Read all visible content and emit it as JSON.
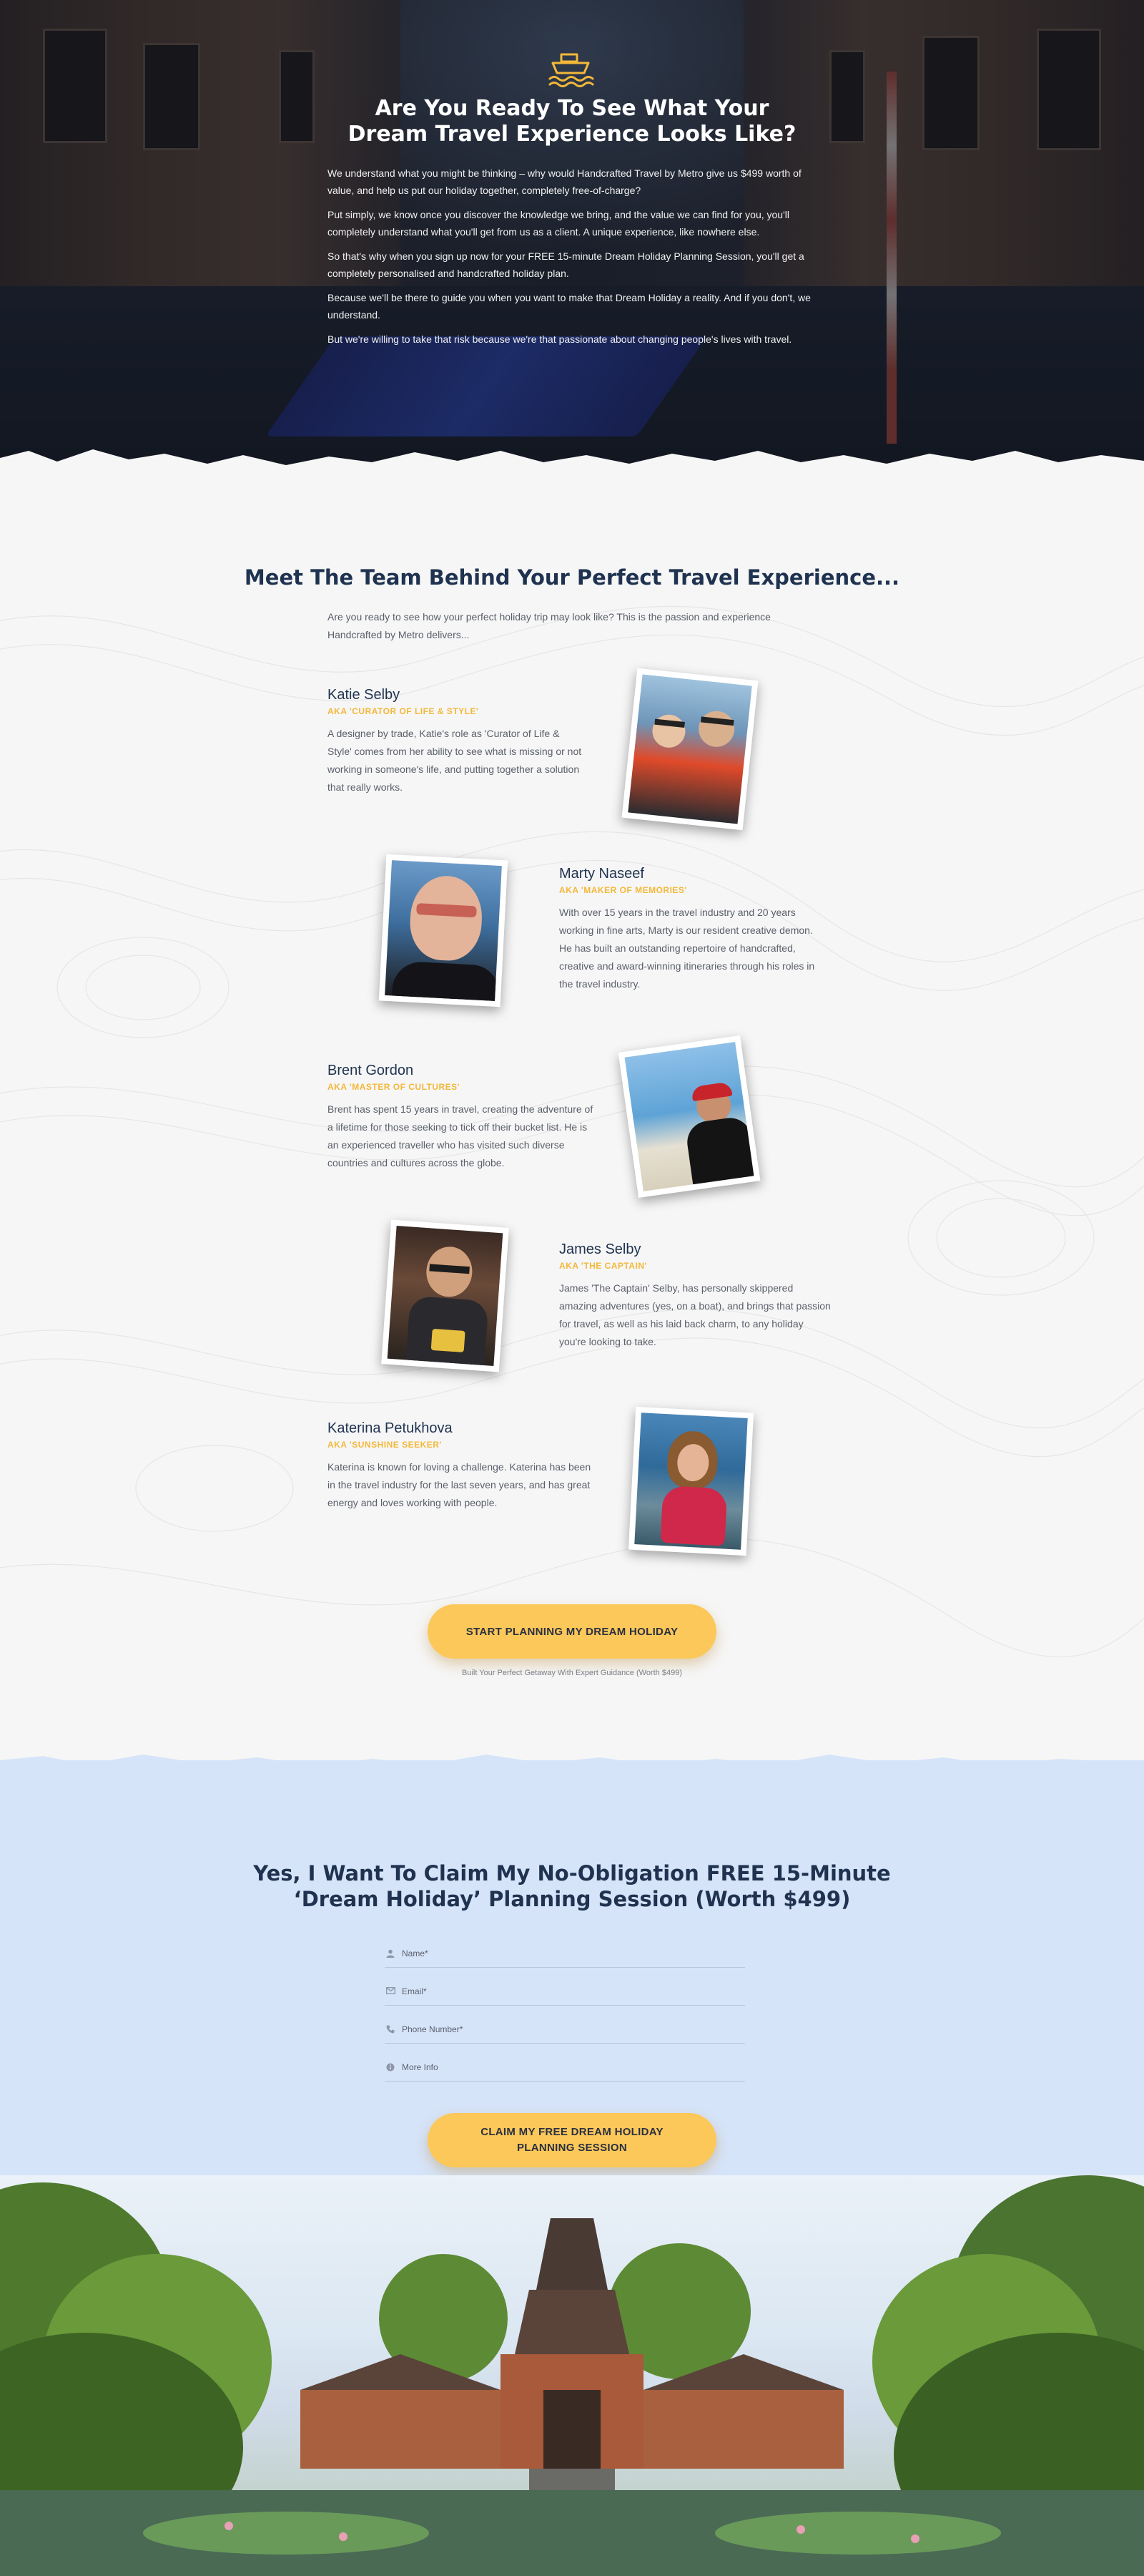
{
  "hero": {
    "icon": "ship-icon",
    "title_line1": "Are You Ready To See What Your",
    "title_line2": "Dream Travel Experience Looks Like?",
    "paragraphs": [
      "We understand what you might be thinking – why would Handcrafted Travel by Metro give us $499 worth of value, and help us put our holiday together, completely free-of-charge?",
      "Put simply, we know once you discover the knowledge we bring, and the value we can find for you, you'll completely understand what you'll get from us as a client. A unique experience, like nowhere else.",
      "So that's why when you sign up now for your FREE 15-minute Dream Holiday Planning Session, you'll get a completely personalised and handcrafted holiday plan.",
      "Because we'll be there to guide you when you want to make that Dream Holiday a reality. And if you don't, we understand.",
      "But we're willing to take that risk because we're that passionate about changing people's lives with travel."
    ]
  },
  "team": {
    "title": "Meet The Team Behind Your Perfect Travel Experience...",
    "intro": "Are you ready to see how your perfect holiday trip may look like? This is the passion and experience Handcrafted by Metro delivers...",
    "members": [
      {
        "name": "Katie Selby",
        "aka": "AKA 'CURATOR OF LIFE & STYLE'",
        "bio": "A designer by trade, Katie's role as 'Curator of Life & Style' comes from her ability to see what is missing or not working in someone's life, and putting together a solution that really works."
      },
      {
        "name": "Marty Naseef",
        "aka": "AKA 'MAKER OF MEMORIES'",
        "bio": "With over 15 years in the travel industry and 20 years working in fine arts, Marty is our resident creative demon. He has built an outstanding repertoire of handcrafted, creative and award-winning itineraries through his roles in the travel industry."
      },
      {
        "name": "Brent Gordon",
        "aka": "AKA 'MASTER OF CULTURES'",
        "bio": "Brent has spent 15 years in travel, creating the adventure of a lifetime for those seeking to tick off their bucket list. He is an experienced traveller who has visited such diverse countries and cultures across the globe."
      },
      {
        "name": "James Selby",
        "aka": "AKA 'THE CAPTAIN'",
        "bio": "James 'The Captain' Selby, has personally skippered amazing adventures (yes, on a boat), and brings that passion for travel, as well as his laid back charm, to any holiday you're looking to take."
      },
      {
        "name": "Katerina Petukhova",
        "aka": "AKA 'SUNSHINE SEEKER'",
        "bio": "Katerina is known for loving a challenge. Katerina has been in the travel industry for the last seven years, and has great energy and loves working with people."
      }
    ],
    "cta_label": "START PLANNING MY DREAM HOLIDAY",
    "cta_sub": "Built Your Perfect Getaway With Expert Guidance (Worth $499)"
  },
  "form": {
    "title_line1": "Yes, I Want To Claim My No-Obligation FREE 15-Minute",
    "title_line2": "‘Dream Holiday’ Planning Session (Worth $499)",
    "fields": [
      {
        "icon": "user-icon",
        "placeholder": "Name*"
      },
      {
        "icon": "mail-icon",
        "placeholder": "Email*"
      },
      {
        "icon": "phone-icon",
        "placeholder": "Phone Number*"
      },
      {
        "icon": "info-icon",
        "placeholder": "More Info"
      }
    ],
    "submit_line1": "CLAIM MY FREE DREAM HOLIDAY",
    "submit_line2": "PLANNING SESSION"
  },
  "colors": {
    "accent": "#fcc85a",
    "aka": "#f3b83a",
    "heading": "#1f3350",
    "form_bg": "#d6e4f9"
  }
}
